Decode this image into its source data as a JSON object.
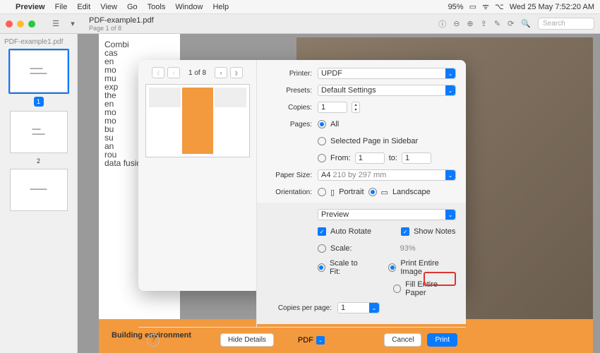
{
  "menubar": {
    "app": "Preview",
    "items": [
      "File",
      "Edit",
      "View",
      "Go",
      "Tools",
      "Window",
      "Help"
    ],
    "battery": "95%",
    "clock": "Wed 25 May  7:52:20 AM"
  },
  "toolbar": {
    "title": "PDF-example1.pdf",
    "subtitle": "Page 1 of 8",
    "search_placeholder": "Search"
  },
  "sidebar": {
    "title": "PDF-example1.pdf",
    "thumbs": [
      "1",
      "2",
      ""
    ]
  },
  "page": {
    "snippet_lines": [
      "Combi",
      "cas",
      "en",
      "mo",
      "mu",
      "exp",
      "the",
      "en",
      "mo",
      "mo",
      "bu",
      "su",
      "an",
      "rou",
      "data fusion."
    ],
    "banner": "Building environment"
  },
  "dialog": {
    "nav": {
      "page_indicator": "1 of 8"
    },
    "labels": {
      "printer": "Printer:",
      "presets": "Presets:",
      "copies": "Copies:",
      "pages": "Pages:",
      "paper_size": "Paper Size:",
      "orientation": "Orientation:",
      "copies_per_page": "Copies per page:"
    },
    "values": {
      "printer": "UPDF",
      "presets": "Default Settings",
      "copies": "1",
      "pages_all": "All",
      "pages_selected": "Selected Page in Sidebar",
      "pages_from_label": "From:",
      "pages_from": "1",
      "pages_to_label": "to:",
      "pages_to": "1",
      "paper_size": "A4",
      "paper_dims": "210 by 297 mm",
      "portrait": "Portrait",
      "landscape": "Landscape",
      "preview_section": "Preview",
      "auto_rotate": "Auto Rotate",
      "show_notes": "Show Notes",
      "scale": "Scale:",
      "scale_pct": "93%",
      "scale_to_fit": "Scale to Fit:",
      "print_entire": "Print Entire Image",
      "fill_entire": "Fill Entire Paper",
      "copies_per_page": "1"
    },
    "footer": {
      "hide_details": "Hide Details",
      "pdf": "PDF",
      "cancel": "Cancel",
      "print": "Print"
    }
  }
}
